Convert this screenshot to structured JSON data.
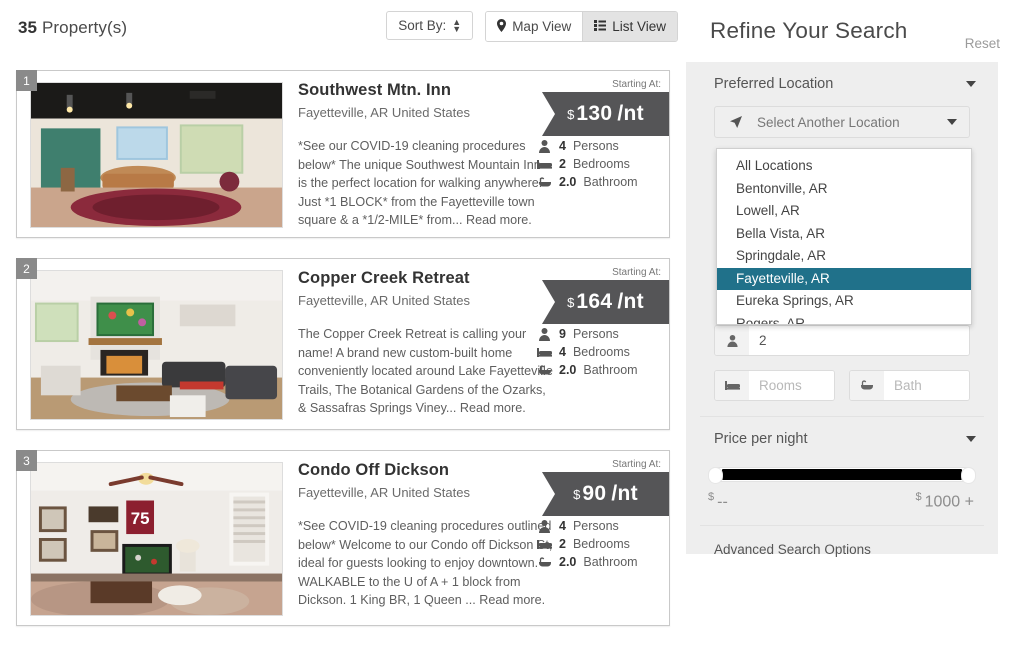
{
  "results": {
    "count": "35",
    "count_label": "Property(s)",
    "sort_button": "Sort By:",
    "map_view": "Map View",
    "list_view": "List View",
    "starting_at_label": "Starting At:",
    "currency_symbol": "$",
    "rate_suffix": "/nt",
    "cards": [
      {
        "badge": "1",
        "title": "Southwest Mtn. Inn",
        "location": "Fayetteville, AR United States",
        "description": "*See our COVID-19 cleaning procedures below* The unique Southwest Mountain Inn is the perfect location for walking anywhere! Just *1 BLOCK* from the Fayetteville town square & a *1/2-MILE* from... Read more.",
        "price": "130",
        "persons_value": "4",
        "persons_label": "Persons",
        "bedrooms_value": "2",
        "bedrooms_label": "Bedrooms",
        "bathroom_value": "2.0",
        "bathroom_label": "Bathroom"
      },
      {
        "badge": "2",
        "title": "Copper Creek Retreat",
        "location": "Fayetteville, AR United States",
        "description": "The Copper Creek Retreat is calling your name! A brand new custom-built home conveniently located around Lake Fayetteville Trails, The Botanical Gardens of the Ozarks, & Sassafras Springs Viney... Read more.",
        "price": "164",
        "persons_value": "9",
        "persons_label": "Persons",
        "bedrooms_value": "4",
        "bedrooms_label": "Bedrooms",
        "bathroom_value": "2.0",
        "bathroom_label": "Bathroom"
      },
      {
        "badge": "3",
        "title": "Condo Off Dickson",
        "location": "Fayetteville, AR United States",
        "description": "*See COVID-19 cleaning procedures outlined below* Welcome to our Condo off Dickson St, ideal for guests looking to enjoy downtown. WALKABLE to the U of A + 1 block from Dickson. 1 King BR, 1 Queen ... Read more.",
        "price": "90",
        "persons_value": "4",
        "persons_label": "Persons",
        "bedrooms_value": "2",
        "bedrooms_label": "Bedrooms",
        "bathroom_value": "2.0",
        "bathroom_label": "Bathroom"
      }
    ]
  },
  "refine": {
    "title": "Refine Your Search",
    "reset": "Reset",
    "preferred_location_label": "Preferred Location",
    "location_select_value": "Select Another Location",
    "location_options": [
      "All Locations",
      "Bentonville, AR",
      "Lowell, AR",
      "Bella Vista, AR",
      "Springdale, AR",
      "Fayetteville, AR",
      "Eureka Springs, AR",
      "Rogers, AR"
    ],
    "selected_location": "Fayetteville, AR",
    "guests_value": "2",
    "rooms_placeholder": "Rooms",
    "bath_placeholder": "Bath",
    "price_section_label": "Price per night",
    "price_min_label": "--",
    "price_max_label": "1000 +",
    "currency_symbol": "$",
    "advanced_options": "Advanced Search Options",
    "accent_color": "#20718a"
  }
}
